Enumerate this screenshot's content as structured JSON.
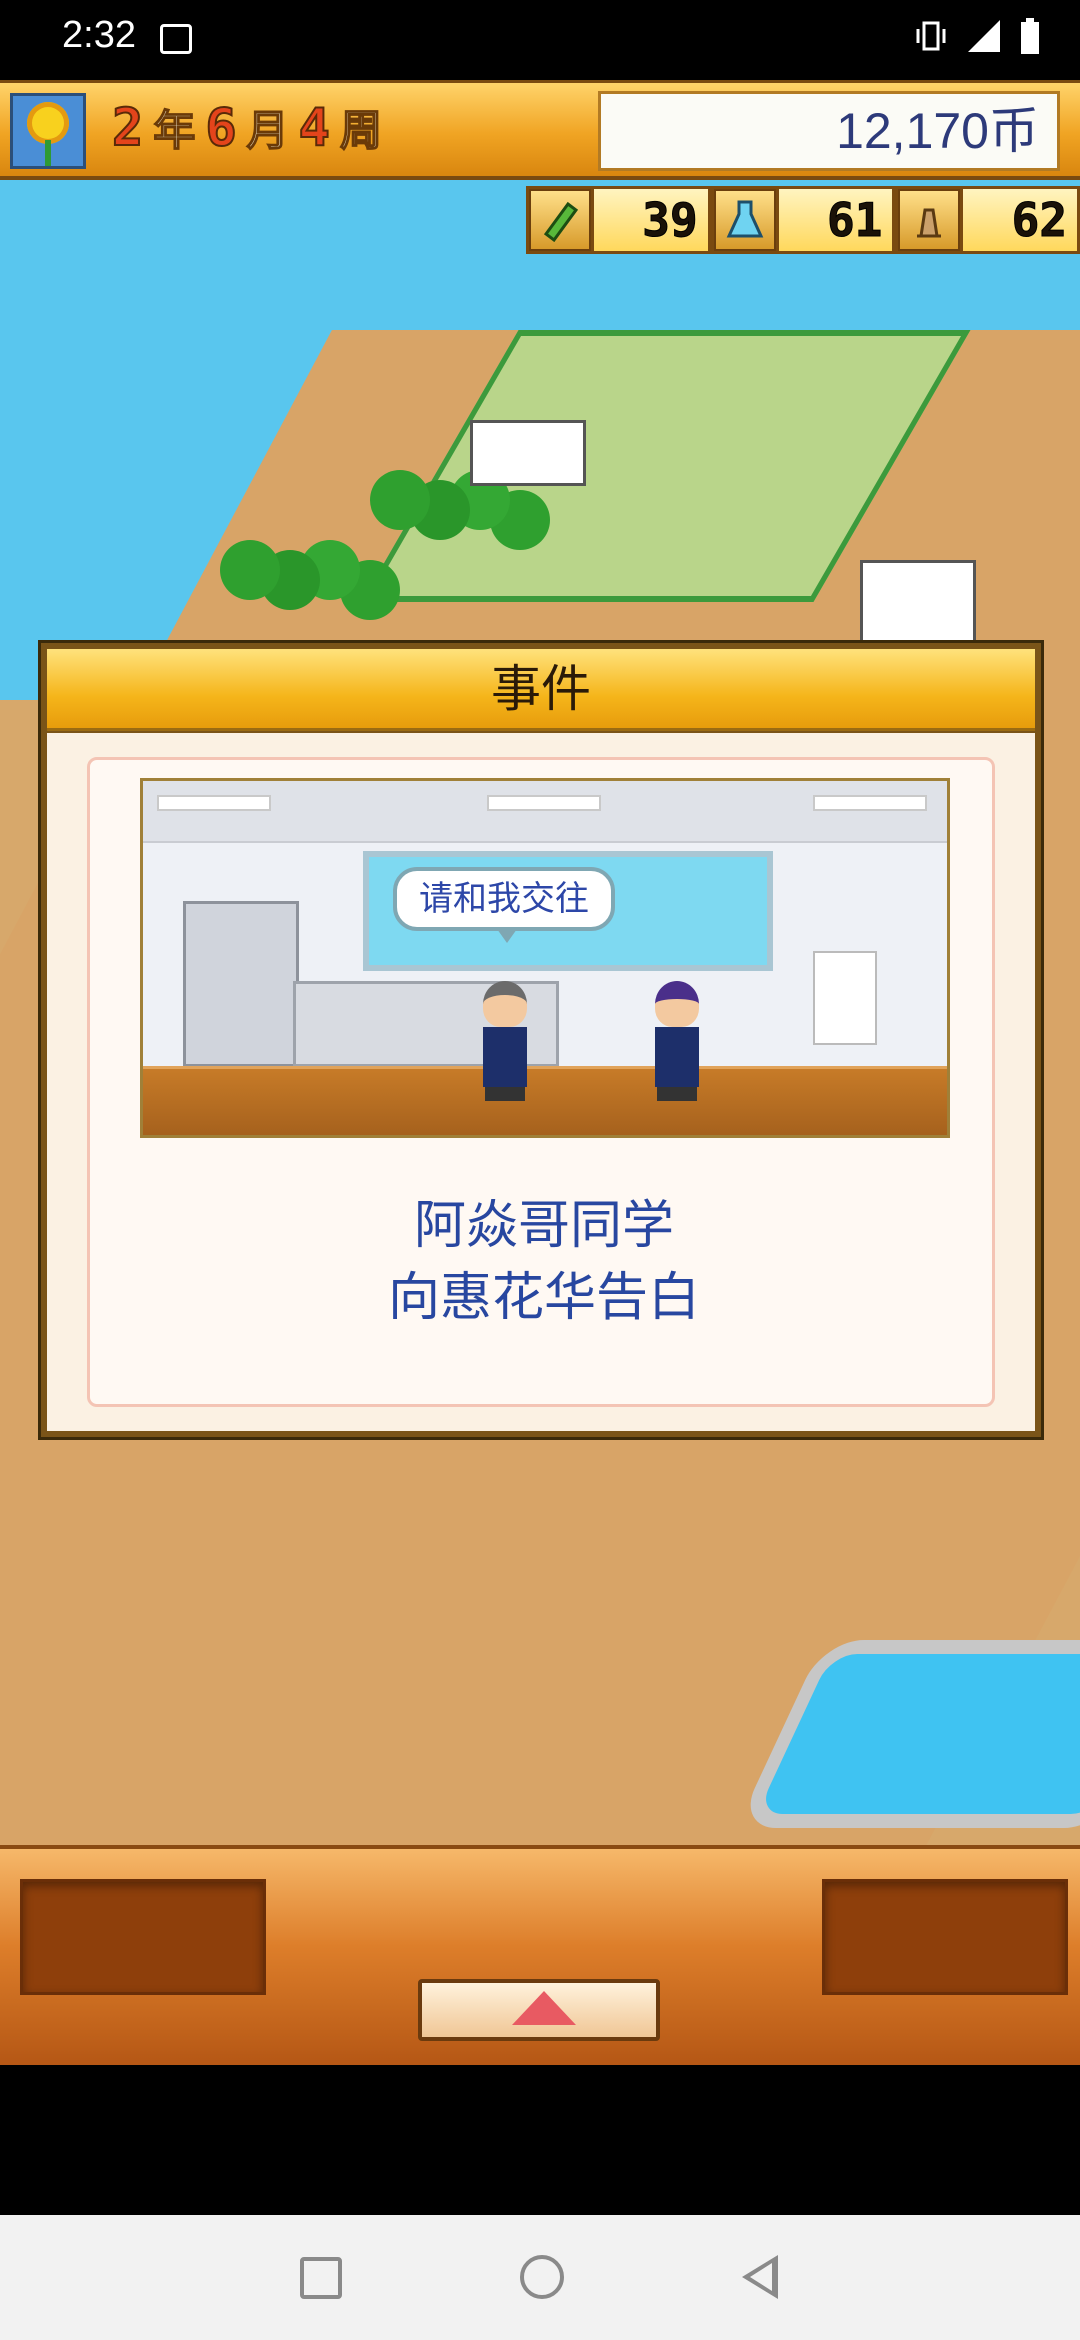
{
  "status_bar": {
    "time": "2:32"
  },
  "top_bar": {
    "year": "2",
    "year_unit": "年",
    "month": "6",
    "month_unit": "月",
    "week": "4",
    "week_unit": "周",
    "money": "12,170币"
  },
  "stats": [
    {
      "icon": "pencil-icon",
      "value": "39"
    },
    {
      "icon": "flask-icon",
      "value": "61"
    },
    {
      "icon": "trophy-icon",
      "value": "62"
    }
  ],
  "event_dialog": {
    "title": "事件",
    "speech": "请和我交往",
    "message_line1": "阿焱哥同学",
    "message_line2": "向惠花华告白"
  },
  "colors": {
    "accent_orange": "#f0a423",
    "message_blue": "#2847a0",
    "panel_brown": "#7a5418"
  }
}
